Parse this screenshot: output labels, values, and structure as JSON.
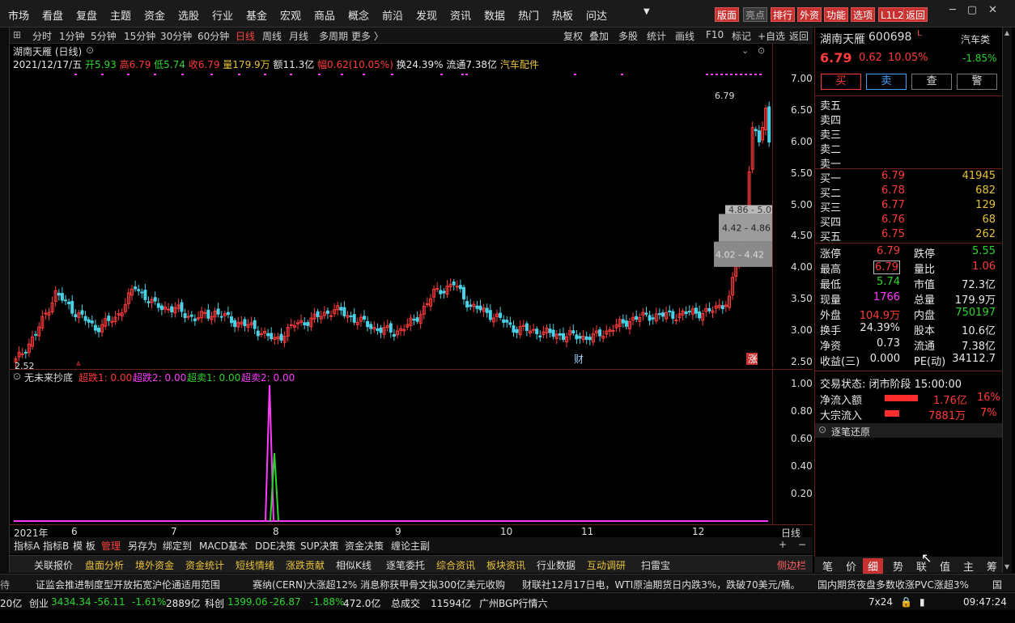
{
  "menu": [
    "市场",
    "看盘",
    "复盘",
    "主题",
    "资金",
    "选股",
    "行业",
    "基金",
    "宏观",
    "商品",
    "概念",
    "前沿",
    "发现",
    "资讯",
    "数据",
    "热门",
    "热板",
    "问达"
  ],
  "top_buttons": [
    "版面",
    "亮点",
    "排行",
    "外资",
    "功能",
    "选项",
    "L1L2",
    "返回"
  ],
  "periods": [
    "分时",
    "1分钟",
    "5分钟",
    "15分钟",
    "30分钟",
    "60分钟",
    "日线",
    "周线",
    "月线",
    "多周期",
    "更多 〉"
  ],
  "tools": [
    "复权",
    "叠加",
    "多股",
    "统计",
    "画线",
    "F10",
    "标记",
    "+自选",
    "返回"
  ],
  "stock": {
    "name": "湖南天雁",
    "code": "600698",
    "chart_title": "湖南天雁 (日线)",
    "board": "汽车类",
    "price": "6.79",
    "change": "0.62",
    "pct": "10.05%",
    "pct_board": "-1.85%",
    "l_badge": "L"
  },
  "info_line": {
    "date": "2021/12/17/五",
    "open": "开5.93",
    "high": "高6.79",
    "low": "低5.74",
    "close": "收6.79",
    "vol": "量179.9万",
    "amt": "额11.3亿",
    "amp": "幅0.62(10.05%)",
    "turn": "换24.39%",
    "float": "流通7.38亿",
    "sector": "汽车配件"
  },
  "trade_buttons": [
    "买",
    "卖",
    "查",
    "警"
  ],
  "sell_levels": [
    "卖五",
    "卖四",
    "卖三",
    "卖二",
    "卖一"
  ],
  "buy_levels": [
    {
      "label": "买一",
      "price": "6.79",
      "vol": "41945"
    },
    {
      "label": "买二",
      "price": "6.78",
      "vol": "682"
    },
    {
      "label": "买三",
      "price": "6.77",
      "vol": "129"
    },
    {
      "label": "买四",
      "price": "6.76",
      "vol": "68"
    },
    {
      "label": "买五",
      "price": "6.75",
      "vol": "262"
    }
  ],
  "stats": [
    {
      "l1": "涨停",
      "v1": "6.79",
      "c1": "red",
      "l2": "跌停",
      "v2": "5.55",
      "c2": "green"
    },
    {
      "l1": "最高",
      "v1": "6.79",
      "c1": "red",
      "l2": "量比",
      "v2": "1.06",
      "c2": "red"
    },
    {
      "l1": "最低",
      "v1": "5.74",
      "c1": "green",
      "l2": "市值",
      "v2": "72.3亿",
      "c2": "white"
    },
    {
      "l1": "现量",
      "v1": "1766",
      "c1": "magenta",
      "l2": "总量",
      "v2": "179.9万",
      "c2": "white"
    },
    {
      "l1": "外盘",
      "v1": "104.9万",
      "c1": "red",
      "l2": "内盘",
      "v2": "750197",
      "c2": "green"
    },
    {
      "l1": "换手",
      "v1": "24.39%",
      "c1": "white",
      "l2": "股本",
      "v2": "10.6亿",
      "c2": "white"
    },
    {
      "l1": "净资",
      "v1": "0.73",
      "c1": "white",
      "l2": "流通",
      "v2": "7.38亿",
      "c2": "white"
    },
    {
      "l1": "收益(三)",
      "v1": "0.000",
      "c1": "white",
      "l2": "PE(动)",
      "v2": "34112.7",
      "c2": "white"
    }
  ],
  "trade_status": "交易状态: 闭市阶段 15:00:00",
  "net_inflow": {
    "label": "净流入额",
    "value": "1.76亿",
    "pct": "16%",
    "fill": 0.45
  },
  "block_inflow": {
    "label": "大宗流入",
    "value": "7881万",
    "pct": "7%",
    "fill": 0.2
  },
  "tick_restore": "逐笔还原",
  "right_tabs": [
    "笔",
    "价",
    "细",
    "势",
    "联",
    "值",
    "主",
    "筹"
  ],
  "indicator": {
    "name": "无未来抄底",
    "s1": "超跌1: 0.00",
    "s2": "超跌2: 0.00",
    "s3": "超卖1: 0.00",
    "s4": "超卖2: 0.00"
  },
  "chart_labels": {
    "low_mark": "2.52",
    "high_mark": "6.79",
    "box1": "4.86 - 5.0",
    "box2": "4.42 - 4.86",
    "box3": "4.02 - 4.42",
    "cai": "财",
    "zhang": "涨",
    "year": "2021年",
    "dayline": "日线"
  },
  "x_ticks": [
    "6",
    "7",
    "8",
    "9",
    "10",
    "11",
    "12"
  ],
  "toolbar2": [
    "指标A",
    "指标B",
    "模 板",
    "管理",
    "另存为",
    "绑定到",
    "MACD基本",
    "DDE决策",
    "SUP决策",
    "资金决策",
    "缠论主副"
  ],
  "bottom_nav": [
    "关联报价",
    "盘面分析",
    "境外资金",
    "资金统计",
    "短线情绪",
    "涨跌贡献",
    "相似K线",
    "逐笔委托",
    "综合资讯",
    "板块资讯",
    "行业数据",
    "互动调研",
    "扫雷宝"
  ],
  "side_label": "侧边栏",
  "news": [
    "证监会推进制度型开放拓宽沪伦通适用范围",
    "赛纳(CERN)大涨超12% 消息称获甲骨文拟300亿美元收购",
    "财联社12月17日电，WTI原油期货日内跌3%，跌破70美元/桶。",
    "国内期货夜盘多数收涨PVC涨超3%"
  ],
  "status": {
    "chuangye_label": "创业",
    "chuangye": "3434.34",
    "chuangye_chg": "-56.11",
    "chuangye_pct": "-1.61%",
    "chuangye_amt": "2889亿",
    "kechuang_label": "科创",
    "kechuang": "1399.06",
    "kechuang_chg": "-26.87",
    "kechuang_pct": "-1.88%",
    "kechuang_amt": "472.0亿",
    "total_label": "总成交",
    "total": "11594亿",
    "broker": "广州BGP行情六",
    "grid": "7x24",
    "time": "09:47:24",
    "amt_prefix": "20亿"
  },
  "chart_data": {
    "type": "candlestick",
    "ylim": [
      2.4,
      7.1
    ],
    "yticks": [
      2.5,
      3.0,
      3.5,
      4.0,
      4.5,
      5.0,
      5.5,
      6.0,
      6.5,
      7.0
    ],
    "ind_ticks": [
      "1.00",
      "0.80",
      "0.60",
      "0.40",
      "0.20"
    ],
    "anchors": [
      [
        0,
        2.52
      ],
      [
        6,
        2.95
      ],
      [
        12,
        3.6
      ],
      [
        18,
        3.3
      ],
      [
        24,
        3.05
      ],
      [
        30,
        3.2
      ],
      [
        36,
        3.7
      ],
      [
        42,
        3.4
      ],
      [
        48,
        3.35
      ],
      [
        54,
        3.2
      ],
      [
        60,
        3.3
      ],
      [
        66,
        3.15
      ],
      [
        72,
        3.05
      ],
      [
        78,
        2.85
      ],
      [
        84,
        3.1
      ],
      [
        90,
        3.2
      ],
      [
        96,
        3.35
      ],
      [
        102,
        3.2
      ],
      [
        108,
        3.05
      ],
      [
        114,
        2.98
      ],
      [
        120,
        3.15
      ],
      [
        126,
        3.6
      ],
      [
        132,
        3.75
      ],
      [
        137,
        3.4
      ],
      [
        144,
        3.25
      ],
      [
        150,
        3.05
      ],
      [
        156,
        3.0
      ],
      [
        162,
        2.95
      ],
      [
        168,
        2.92
      ],
      [
        174,
        2.9
      ],
      [
        180,
        3.05
      ],
      [
        186,
        3.2
      ],
      [
        192,
        3.25
      ],
      [
        198,
        3.25
      ],
      [
        204,
        3.3
      ],
      [
        209,
        3.3
      ],
      [
        215,
        3.5
      ],
      [
        218,
        4.4
      ],
      [
        220,
        5.0
      ],
      [
        222,
        6.2
      ],
      [
        224,
        6.0
      ],
      [
        227,
        6.79
      ]
    ]
  }
}
